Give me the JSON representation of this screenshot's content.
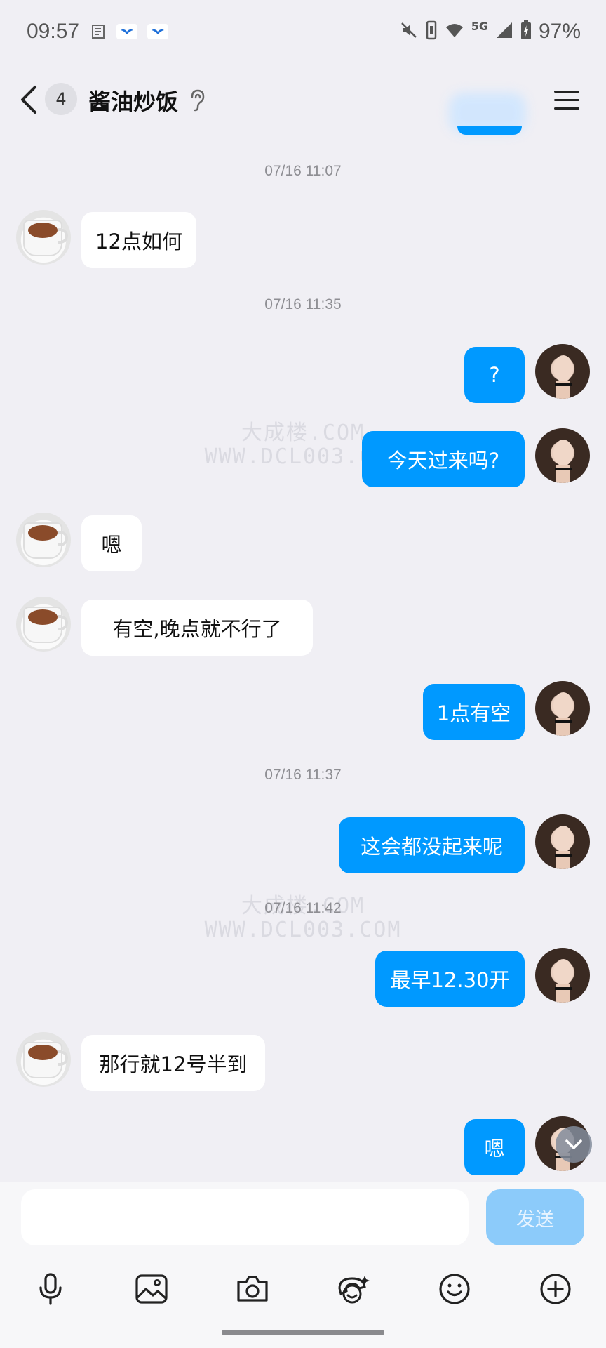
{
  "status_bar": {
    "time": "09:57",
    "network": "5G",
    "battery": "97%",
    "icons": [
      "notification-icon",
      "bird-app-icon",
      "bird-app-icon",
      "mute-icon",
      "vibrate-icon",
      "wifi-icon",
      "signal-icon",
      "battery-icon"
    ]
  },
  "header": {
    "unread_count": "4",
    "title": "酱油炒饭",
    "icons": [
      "back-icon",
      "ear-icon",
      "menu-icon"
    ]
  },
  "watermarks": [
    {
      "line1": "大成楼.COM",
      "line2": "WWW.DCL003.COM"
    },
    {
      "line1": "大成楼.COM",
      "line2": "WWW.DCL003.COM"
    }
  ],
  "messages": [
    {
      "kind": "time",
      "text": "07/16 11:07"
    },
    {
      "kind": "in",
      "text": "12点如何"
    },
    {
      "kind": "time",
      "text": "07/16 11:35"
    },
    {
      "kind": "out",
      "text": "?"
    },
    {
      "kind": "out",
      "text": "今天过来吗?"
    },
    {
      "kind": "in",
      "text": "嗯"
    },
    {
      "kind": "in",
      "text": "有空,晚点就不行了"
    },
    {
      "kind": "out",
      "text": "1点有空"
    },
    {
      "kind": "time",
      "text": "07/16 11:37"
    },
    {
      "kind": "out",
      "text": "这会都没起来呢"
    },
    {
      "kind": "time",
      "text": "07/16 11:42"
    },
    {
      "kind": "out",
      "text": "最早12.30开"
    },
    {
      "kind": "in",
      "text": "那行就12号半到"
    },
    {
      "kind": "out",
      "text": "嗯"
    }
  ],
  "composer": {
    "input_value": "",
    "send_label": "发送"
  },
  "toolbar": [
    "microphone-icon",
    "image-icon",
    "camera-icon",
    "sticker-icon",
    "emoji-icon",
    "plus-icon"
  ],
  "colors": {
    "background": "#f0eff4",
    "outgoing_bubble": "#0099ff",
    "incoming_bubble": "#ffffff",
    "send_button_disabled": "#8ccbfa",
    "timestamp": "#8e8e93"
  }
}
